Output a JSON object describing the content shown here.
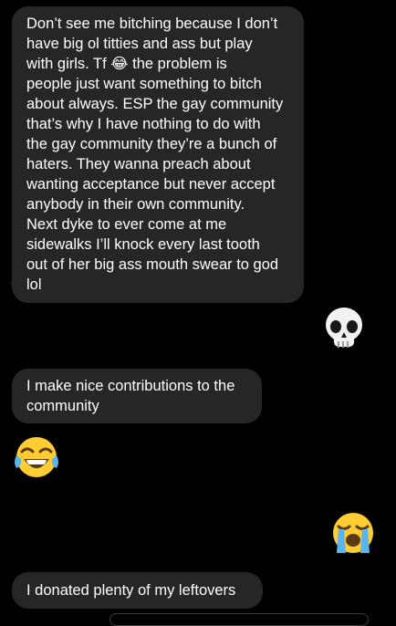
{
  "conversation": {
    "messages": [
      {
        "side": "incoming",
        "text": "Don’t see me bitching because I don’t\nhave big ol titties and ass but play\nwith girls. Tf 😂 the problem is\npeople just want something to bitch\nabout always. ESP the gay community\nthat’s why I have nothing to do with\nthe gay community they’re a bunch of\nhaters. They wanna preach about\nwanting acceptance but never accept\nanybody in their own community.\nNext dyke to ever come at me\nsidewalks I’ll knock every last tooth\nout of her big ass mouth swear to god\nlol"
      },
      {
        "side": "outgoing",
        "emoji": "💀",
        "icon": "skull-emoji"
      },
      {
        "side": "incoming",
        "text": "I make nice contributions to the\ncommunity"
      },
      {
        "side": "incoming",
        "emoji": "😂",
        "icon": "tears-of-joy-emoji"
      },
      {
        "side": "outgoing",
        "emoji": "😭",
        "icon": "loudly-crying-emoji"
      },
      {
        "side": "incoming",
        "text": "I donated plenty of my leftovers"
      }
    ]
  },
  "colors": {
    "background": "#000000",
    "incoming_bubble": "#262628",
    "text": "#ffffff"
  }
}
